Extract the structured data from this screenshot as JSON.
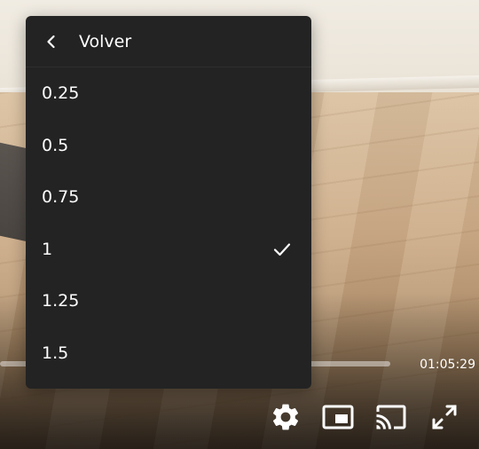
{
  "player": {
    "time_display": "01:05:29",
    "controls": [
      {
        "name": "settings-button",
        "icon": "gear-icon"
      },
      {
        "name": "miniplayer-button",
        "icon": "miniplayer-icon"
      },
      {
        "name": "cast-button",
        "icon": "cast-icon"
      },
      {
        "name": "fullscreen-button",
        "icon": "fullscreen-icon"
      }
    ],
    "accent_color": "#ffffff",
    "menu_background": "#232323"
  },
  "speed_menu": {
    "back_label": "Volver",
    "back_icon": "chevron-left-icon",
    "selected": "1",
    "selected_icon": "check-icon",
    "options": [
      {
        "label": "0.25"
      },
      {
        "label": "0.5"
      },
      {
        "label": "0.75"
      },
      {
        "label": "1"
      },
      {
        "label": "1.25"
      },
      {
        "label": "1.5"
      }
    ]
  }
}
